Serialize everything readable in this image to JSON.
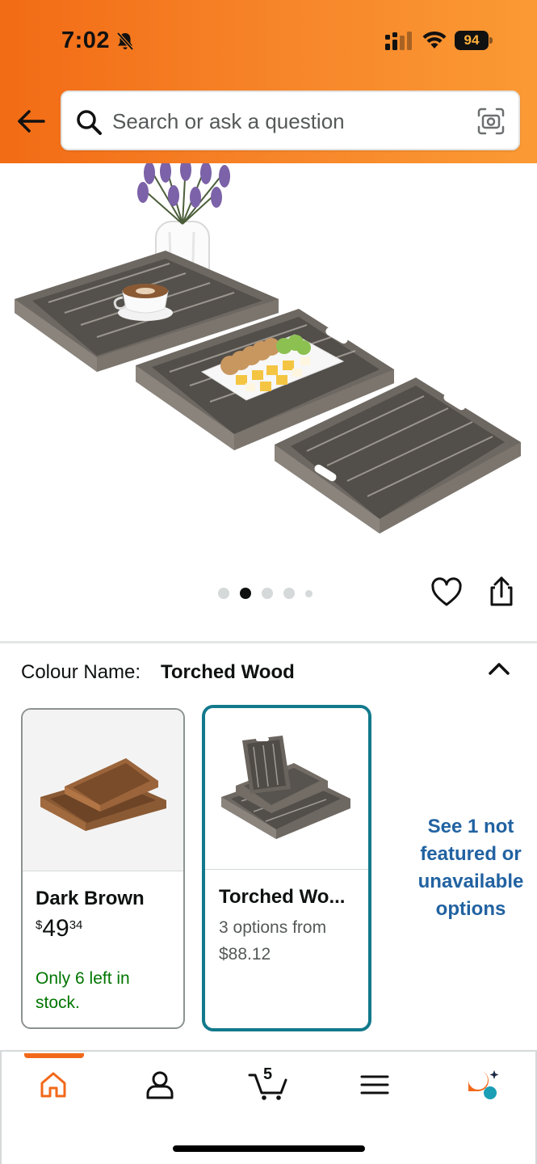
{
  "status_bar": {
    "time": "7:02",
    "battery": "94"
  },
  "search": {
    "placeholder": "Search or ask a question"
  },
  "gallery": {
    "dots_count": 5,
    "active_index": 1
  },
  "colour": {
    "label": "Colour Name:",
    "value": "Torched Wood"
  },
  "variants": [
    {
      "name": "Dark Brown",
      "price_symbol": "$",
      "price_whole": "49",
      "price_fraction": "34",
      "stock_note": "Only 6 left in stock."
    },
    {
      "name": "Torched Wo...",
      "options_text": "3 options from $88.12"
    }
  ],
  "see_more": "See 1 not featured or unavailable options",
  "bottom_nav": {
    "cart_count": "5",
    "active": "home"
  },
  "colors": {
    "header_start": "#f26b15",
    "header_end": "#fb9a34",
    "selected_border": "#12798c",
    "link_blue": "#2162a1",
    "stock_green": "#007600",
    "nav_accent": "#f2681a"
  }
}
